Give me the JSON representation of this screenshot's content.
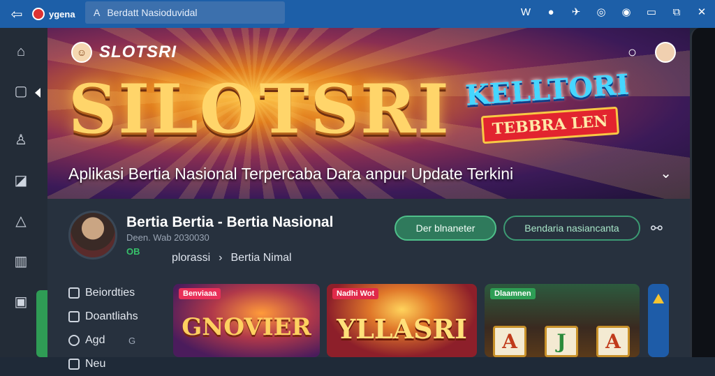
{
  "browser": {
    "site_label": "ygena",
    "address": "Berdatt Nasioduvidal"
  },
  "hero": {
    "logo_text": "SLOTSRI",
    "big_title": "SILOTSRI",
    "badge_line1": "KELLTORI",
    "badge_line2": "TEBBRA LEN",
    "subtitle": "Aplikasi Bertia Nasional Terpercaba Dara anpur Update Terkini"
  },
  "profile": {
    "title": "Bertia Bertia - Bertia Nasional",
    "meta": "Deen. Wab 2030030",
    "badge": "OB"
  },
  "breadcrumb": {
    "item1": "plorassi",
    "separator": "›",
    "item2": "Bertia Nimal"
  },
  "actions": {
    "primary": "Der blnaneter",
    "secondary": "Bendaria nasiancanta"
  },
  "menu": [
    {
      "label": "Beiordties"
    },
    {
      "label": "Doantliahs"
    },
    {
      "label": "Agd",
      "extra": "G"
    },
    {
      "label": "Neu"
    }
  ],
  "cards": [
    {
      "tag": "Benviaaa",
      "title": "GNOVIER"
    },
    {
      "tag": "Nadhi Wot",
      "title": "YLLASRI"
    },
    {
      "tag": "Dlaamnen",
      "reels": [
        "A",
        "J",
        "A"
      ]
    }
  ],
  "colors": {
    "topbar": "#1d5fa8",
    "accent_green": "#2f7a5c",
    "background": "#27313e"
  }
}
